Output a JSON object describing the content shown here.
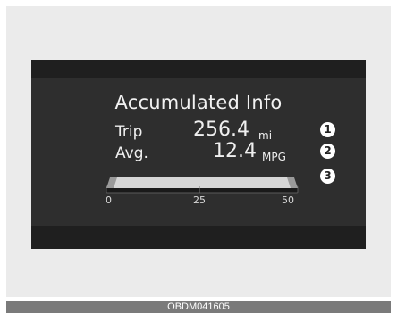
{
  "display": {
    "title": "Accumulated Info",
    "trip": {
      "label": "Trip",
      "value": "256.4",
      "unit": "mi"
    },
    "average": {
      "label": "Avg.",
      "value": "12.4",
      "unit": "MPG"
    },
    "gauge": {
      "min_label": "0",
      "mid_label": "25",
      "max_label": "50",
      "level": 1.0
    }
  },
  "callouts": [
    "1",
    "2",
    "3"
  ],
  "caption": {
    "code": "OBDM041605"
  },
  "colors": {
    "display_background": "#2e2e2e",
    "display_band": "#1f1f1f",
    "text": "#efefef",
    "gauge_fill": "#d6d6d6"
  }
}
